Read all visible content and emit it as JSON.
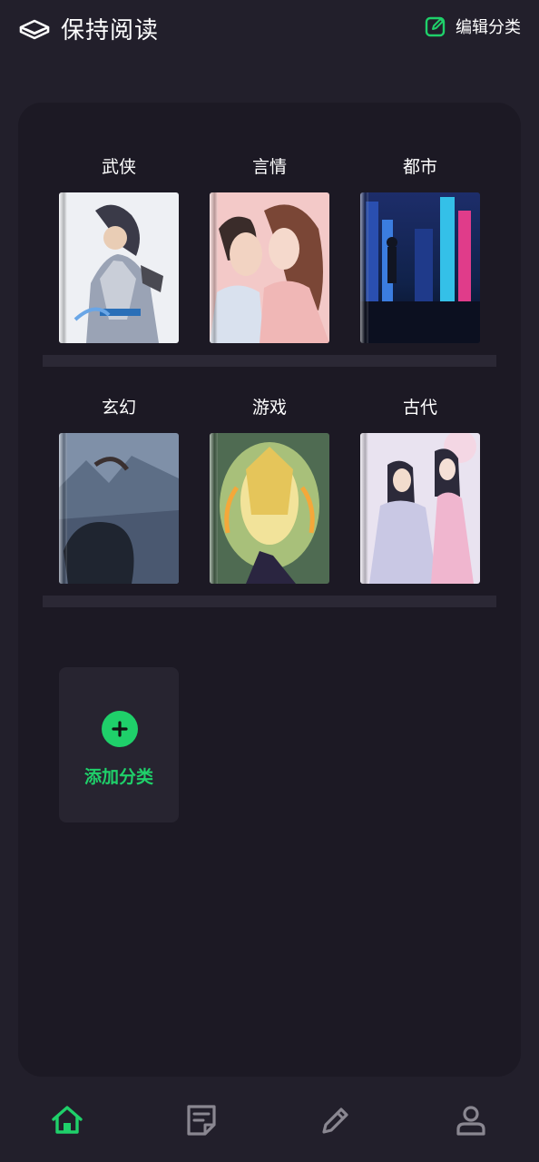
{
  "header": {
    "title": "保持阅读",
    "logo_icon": "book-stack-icon",
    "edit_label": "编辑分类",
    "edit_icon": "edit-square-icon"
  },
  "shelves": [
    {
      "categories": [
        {
          "label": "武侠",
          "cover_icon": "wuxia-swordsman-cover"
        },
        {
          "label": "言情",
          "cover_icon": "romance-couple-cover"
        },
        {
          "label": "都市",
          "cover_icon": "city-neon-cover"
        }
      ]
    },
    {
      "categories": [
        {
          "label": "玄幻",
          "cover_icon": "fantasy-dragon-cover"
        },
        {
          "label": "游戏",
          "cover_icon": "game-warrior-cover"
        },
        {
          "label": "古代",
          "cover_icon": "ancient-couple-cover"
        }
      ]
    }
  ],
  "add_category": {
    "label": "添加分类",
    "icon": "plus-circle-icon"
  },
  "nav": [
    {
      "icon": "home-icon",
      "active": true
    },
    {
      "icon": "note-icon",
      "active": false
    },
    {
      "icon": "pencil-icon",
      "active": false
    },
    {
      "icon": "user-icon",
      "active": false
    }
  ],
  "colors": {
    "accent": "#1fd06a",
    "background": "#221f2b",
    "panel": "#1c1924",
    "inactive_icon": "#8a8791"
  }
}
